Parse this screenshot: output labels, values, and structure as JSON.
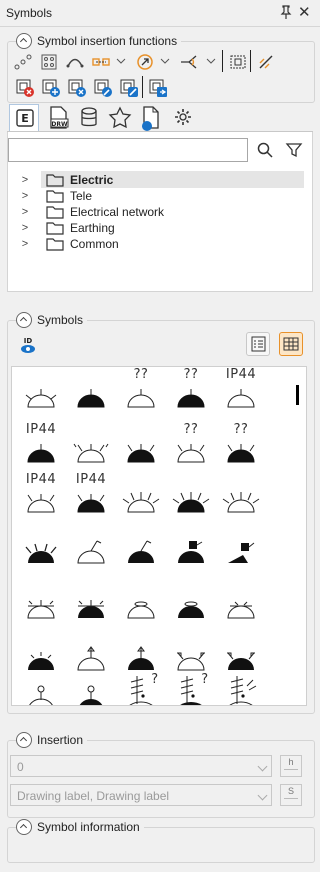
{
  "window": {
    "title": "Symbols"
  },
  "insertion_functions": {
    "label": "Symbol insertion functions"
  },
  "tabs": [
    {
      "name": "electric",
      "label": "E"
    },
    {
      "name": "drawing",
      "label": "DRW"
    },
    {
      "name": "database"
    },
    {
      "name": "favorites"
    },
    {
      "name": "document"
    },
    {
      "name": "settings"
    }
  ],
  "tree": {
    "items": [
      {
        "label": "Electric",
        "selected": true
      },
      {
        "label": "Tele"
      },
      {
        "label": "Electrical network"
      },
      {
        "label": "Earthing"
      },
      {
        "label": "Common"
      }
    ]
  },
  "symbols": {
    "label": "Symbols",
    "id_button": "ID"
  },
  "symbol_labels": {
    "qq": "??",
    "ip": "IP44",
    "q": "?"
  },
  "insertion": {
    "label": "Insertion",
    "level_value": "0",
    "text_value": "Drawing label, Drawing label",
    "h_label": "h",
    "s_label": "S"
  },
  "symbol_information": {
    "label": "Symbol information"
  },
  "colors": {
    "accent": "#e8912a",
    "blue": "#1a73c8",
    "red": "#d9342b"
  }
}
